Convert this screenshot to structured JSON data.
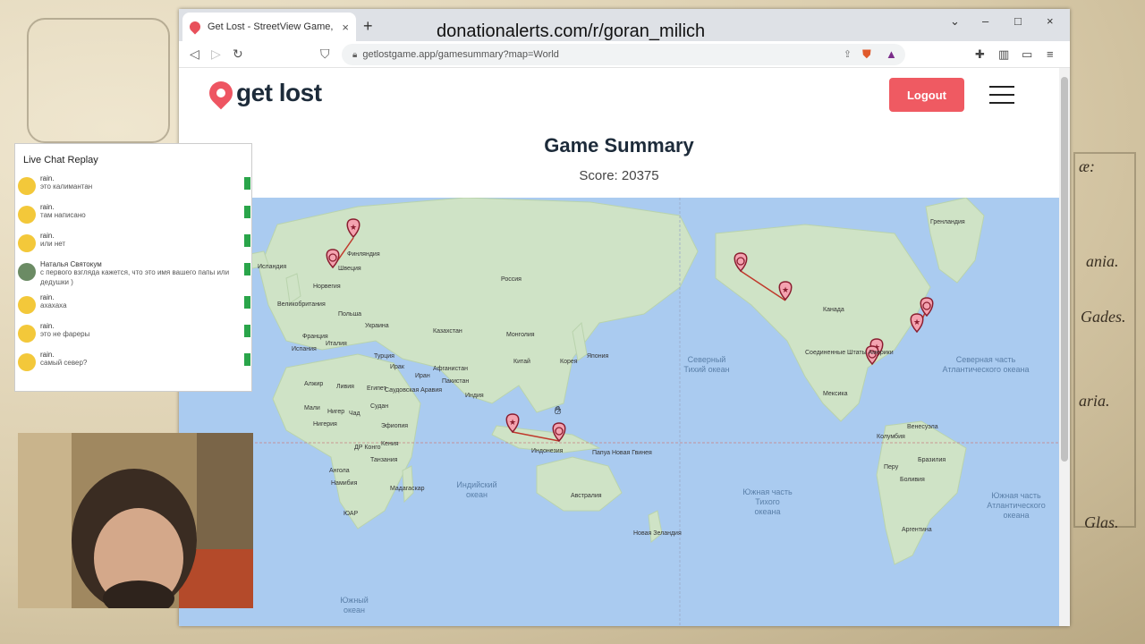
{
  "overlay": {
    "donation_url": "donationalerts.com/r/goran_milich"
  },
  "background_map_text": [
    "æ:",
    "ania.",
    "Gades.",
    "aria.",
    "Glas."
  ],
  "browser": {
    "tab_title": "Get Lost - StreetView Game, Geo",
    "tab_close": "×",
    "new_tab": "+",
    "url": "getlostgame.app/gamesummary?map=World",
    "window_controls": {
      "chevron": "⌄",
      "minimize": "–",
      "maximize": "□",
      "close": "×"
    }
  },
  "page": {
    "logo_text": "get lost",
    "logout_label": "Logout",
    "title": "Game Summary",
    "score": "Score: 20375"
  },
  "map": {
    "labels": [
      "Гренландия",
      "Исландия",
      "Финляндия",
      "Швеция",
      "Норвегия",
      "Великобритания",
      "Польша",
      "Украина",
      "Франция",
      "Италия",
      "Испания",
      "Турция",
      "Казахстан",
      "Монголия",
      "Китай",
      "Корея",
      "Япония",
      "Россия",
      "Иран",
      "Ирак",
      "Афганистан",
      "Пакистан",
      "Индия",
      "Алжир",
      "Ливия",
      "Египет",
      "Саудовская Аравия",
      "Мали",
      "Нигер",
      "Чад",
      "Судан",
      "Нигерия",
      "Эфиопия",
      "ДР Конго",
      "Кения",
      "Танзания",
      "Ангола",
      "Намибия",
      "ЮАР",
      "Мадагаскар",
      "Индонезия",
      "Папуа Новая Гвинея",
      "Австралия",
      "Новая Зеландия",
      "Канада",
      "Соединенные Штаты Америки",
      "Мексика",
      "Венесуэла",
      "Колумбия",
      "Перу",
      "Бразилия",
      "Боливия",
      "Аргентина"
    ],
    "oceans": [
      "Северный Тихий океан",
      "Северная часть Атлантического океана",
      "Индийский океан",
      "Южная часть Тихого океана",
      "Южная часть Атлантического океана",
      "Южный океан"
    ]
  },
  "chat": {
    "header": "Live Chat Replay",
    "messages": [
      {
        "name": "rain.",
        "text": "это калимантан"
      },
      {
        "name": "rain.",
        "text": "там написано"
      },
      {
        "name": "rain.",
        "text": "или нет"
      },
      {
        "name": "Наталья Святокум",
        "text": "с первого взгляда кажется, что это имя вашего папы или дедушки )"
      },
      {
        "name": "rain.",
        "text": "ахахаха"
      },
      {
        "name": "rain.",
        "text": "это не фареры"
      },
      {
        "name": "rain.",
        "text": "самый север?"
      }
    ]
  },
  "colors": {
    "accent": "#ef5a62",
    "ocean": "#aacbf0",
    "land": "#cfe3c6",
    "route": "#c0392b"
  }
}
